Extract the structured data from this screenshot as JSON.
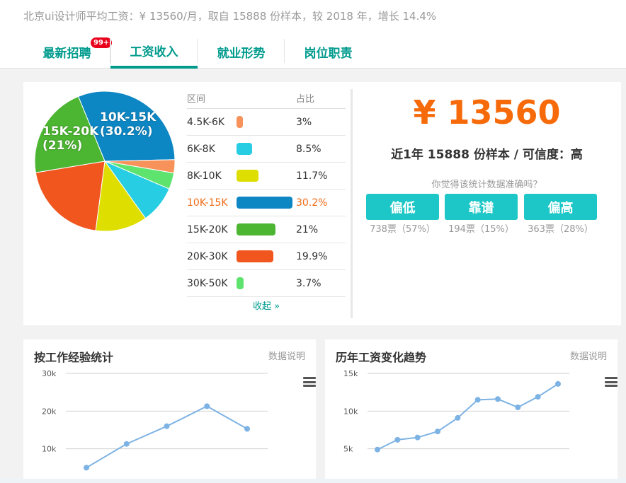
{
  "header": {
    "subtitle": "北京ui设计师平均工资：¥ 13560/月，取自 15888 份样本，较 2018 年，增长 14.4%",
    "tabs": [
      {
        "label": "最新招聘",
        "badge": "99+"
      },
      {
        "label": "工资收入"
      },
      {
        "label": "就业形势"
      },
      {
        "label": "岗位职责"
      }
    ]
  },
  "distribution": {
    "col_range": "区间",
    "col_pct": "占比",
    "collapse_label": "收起 »",
    "pie_labels": {
      "big": "10K-15K\n(30.2%)",
      "second": "15K-20K\n(21%)"
    },
    "rows": [
      {
        "range": "4.5K-6K",
        "pct": "3%",
        "value": 3,
        "color": "#f7925a"
      },
      {
        "range": "6K-8K",
        "pct": "8.5%",
        "value": 8.5,
        "color": "#27cde3"
      },
      {
        "range": "8K-10K",
        "pct": "11.7%",
        "value": 11.7,
        "color": "#dede00"
      },
      {
        "range": "10K-15K",
        "pct": "30.2%",
        "value": 30.2,
        "color": "#0d87c4",
        "highlight": true
      },
      {
        "range": "15K-20K",
        "pct": "21%",
        "value": 21,
        "color": "#4cb532"
      },
      {
        "range": "20K-30K",
        "pct": "19.9%",
        "value": 19.9,
        "color": "#f0561e"
      },
      {
        "range": "30K-50K",
        "pct": "3.7%",
        "value": 3.7,
        "color": "#5ee36f"
      }
    ]
  },
  "summary": {
    "salary": "¥ 13560",
    "sample_text": "近1年 15888 份样本 / 可信度：高",
    "question": "你觉得该统计数据准确吗？",
    "votes": [
      {
        "label": "偏低",
        "count": "738票（57%）"
      },
      {
        "label": "靠谱",
        "count": "194票（15%）"
      },
      {
        "label": "偏高",
        "count": "363票（28%）"
      }
    ]
  },
  "experience_chart": {
    "title": "按工作经验统计",
    "note": "数据说明",
    "chart_data": {
      "type": "line",
      "y_ticks": [
        "30k",
        "20k",
        "10k"
      ],
      "ylim": [
        0,
        30000
      ],
      "values": [
        5000,
        11300,
        16000,
        21300,
        15300
      ],
      "color": "#7db3e4"
    }
  },
  "trend_chart": {
    "title": "历年工资变化趋势",
    "note": "数据说明",
    "chart_data": {
      "type": "line",
      "y_ticks": [
        "15k",
        "10k",
        "5k"
      ],
      "ylim": [
        0,
        15000
      ],
      "values": [
        4900,
        6200,
        6500,
        7300,
        9100,
        11500,
        11600,
        10500,
        11900,
        13600
      ],
      "color": "#7db3e4"
    }
  }
}
